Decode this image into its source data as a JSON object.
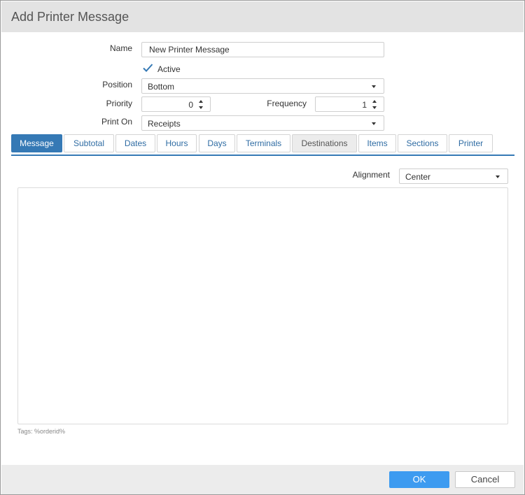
{
  "dialog": {
    "title": "Add Printer Message"
  },
  "form": {
    "name_label": "Name",
    "name_value": "New Printer Message",
    "active_label": "Active",
    "active_checked": true,
    "position_label": "Position",
    "position_value": "Bottom",
    "priority_label": "Priority",
    "priority_value": "0",
    "frequency_label": "Frequency",
    "frequency_value": "1",
    "print_on_label": "Print On",
    "print_on_value": "Receipts"
  },
  "tabs": [
    {
      "label": "Message",
      "state": "active"
    },
    {
      "label": "Subtotal",
      "state": "normal"
    },
    {
      "label": "Dates",
      "state": "normal"
    },
    {
      "label": "Hours",
      "state": "normal"
    },
    {
      "label": "Days",
      "state": "normal"
    },
    {
      "label": "Terminals",
      "state": "normal"
    },
    {
      "label": "Destinations",
      "state": "hover"
    },
    {
      "label": "Items",
      "state": "normal"
    },
    {
      "label": "Sections",
      "state": "normal"
    },
    {
      "label": "Printer",
      "state": "normal"
    }
  ],
  "message_tab": {
    "alignment_label": "Alignment",
    "alignment_value": "Center",
    "message_text": "",
    "tags_hint": "Tags: %orderid%"
  },
  "footer": {
    "ok_label": "OK",
    "cancel_label": "Cancel"
  },
  "colors": {
    "accent": "#3579b5",
    "ok_button": "#3d9bf0",
    "titlebar": "#e3e3e3",
    "footer": "#ececec"
  }
}
